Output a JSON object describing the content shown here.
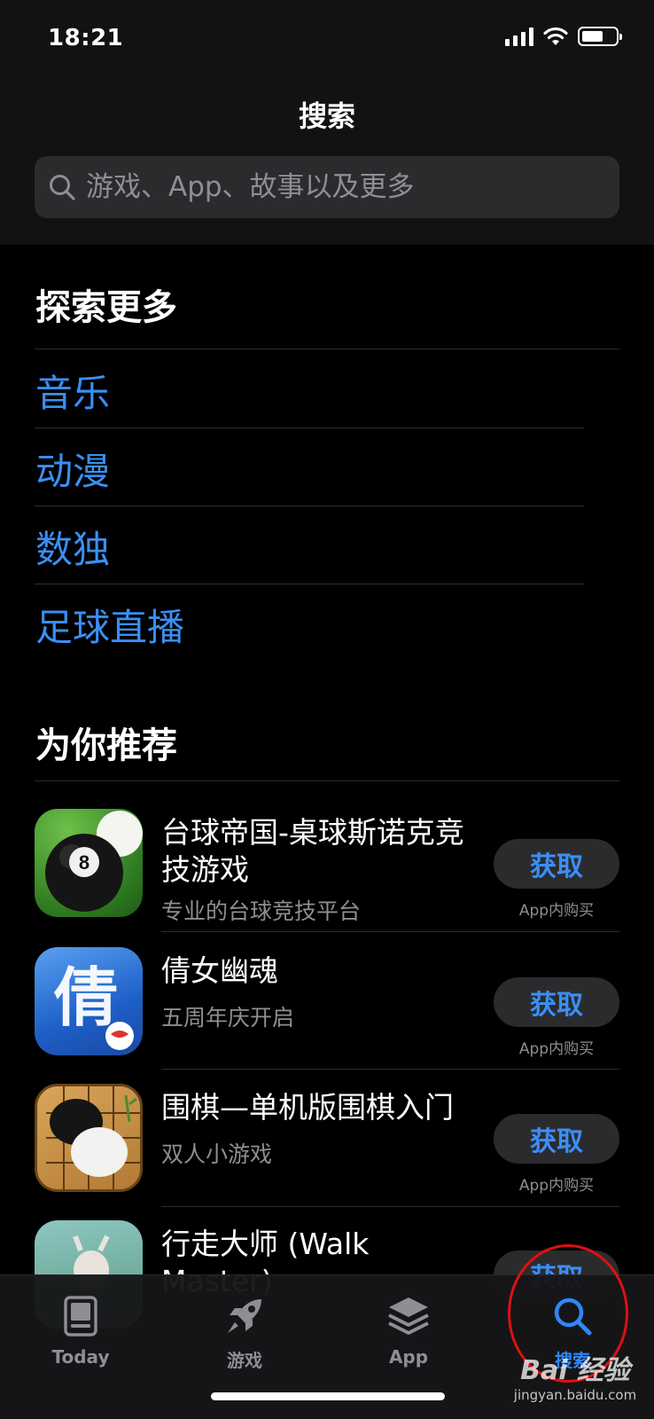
{
  "status_bar": {
    "time": "18:21"
  },
  "header": {
    "title": "搜索",
    "search_placeholder": "游戏、App、故事以及更多"
  },
  "explore": {
    "title": "探索更多",
    "items": [
      "音乐",
      "动漫",
      "数独",
      "足球直播"
    ]
  },
  "recommend": {
    "title": "为你推荐",
    "apps": [
      {
        "name": "台球帝国-桌球斯诺克竞技游戏",
        "subtitle": "专业的台球竞技平台",
        "button": "获取",
        "iap": "App内购买"
      },
      {
        "name": "倩女幽魂",
        "subtitle": "五周年庆开启",
        "button": "获取",
        "iap": "App内购买"
      },
      {
        "name": "围棋—单机版围棋入门",
        "subtitle": "双人小游戏",
        "button": "获取",
        "iap": "App内购买"
      },
      {
        "name": "行走大师 (Walk Master)",
        "subtitle": "",
        "button": "获取",
        "iap": ""
      }
    ]
  },
  "tabbar": {
    "tabs": [
      {
        "label": "Today",
        "icon": "today-icon"
      },
      {
        "label": "游戏",
        "icon": "rocket-icon"
      },
      {
        "label": "App",
        "icon": "apps-layers-icon"
      },
      {
        "label": "搜索",
        "icon": "search-icon"
      }
    ],
    "active_index": 3
  },
  "watermark": {
    "brand": "Bai 经验",
    "url": "jingyan.baidu.com"
  },
  "colors": {
    "accent": "#3a8ff5",
    "background": "#000000",
    "annotation": "#dd1111"
  }
}
